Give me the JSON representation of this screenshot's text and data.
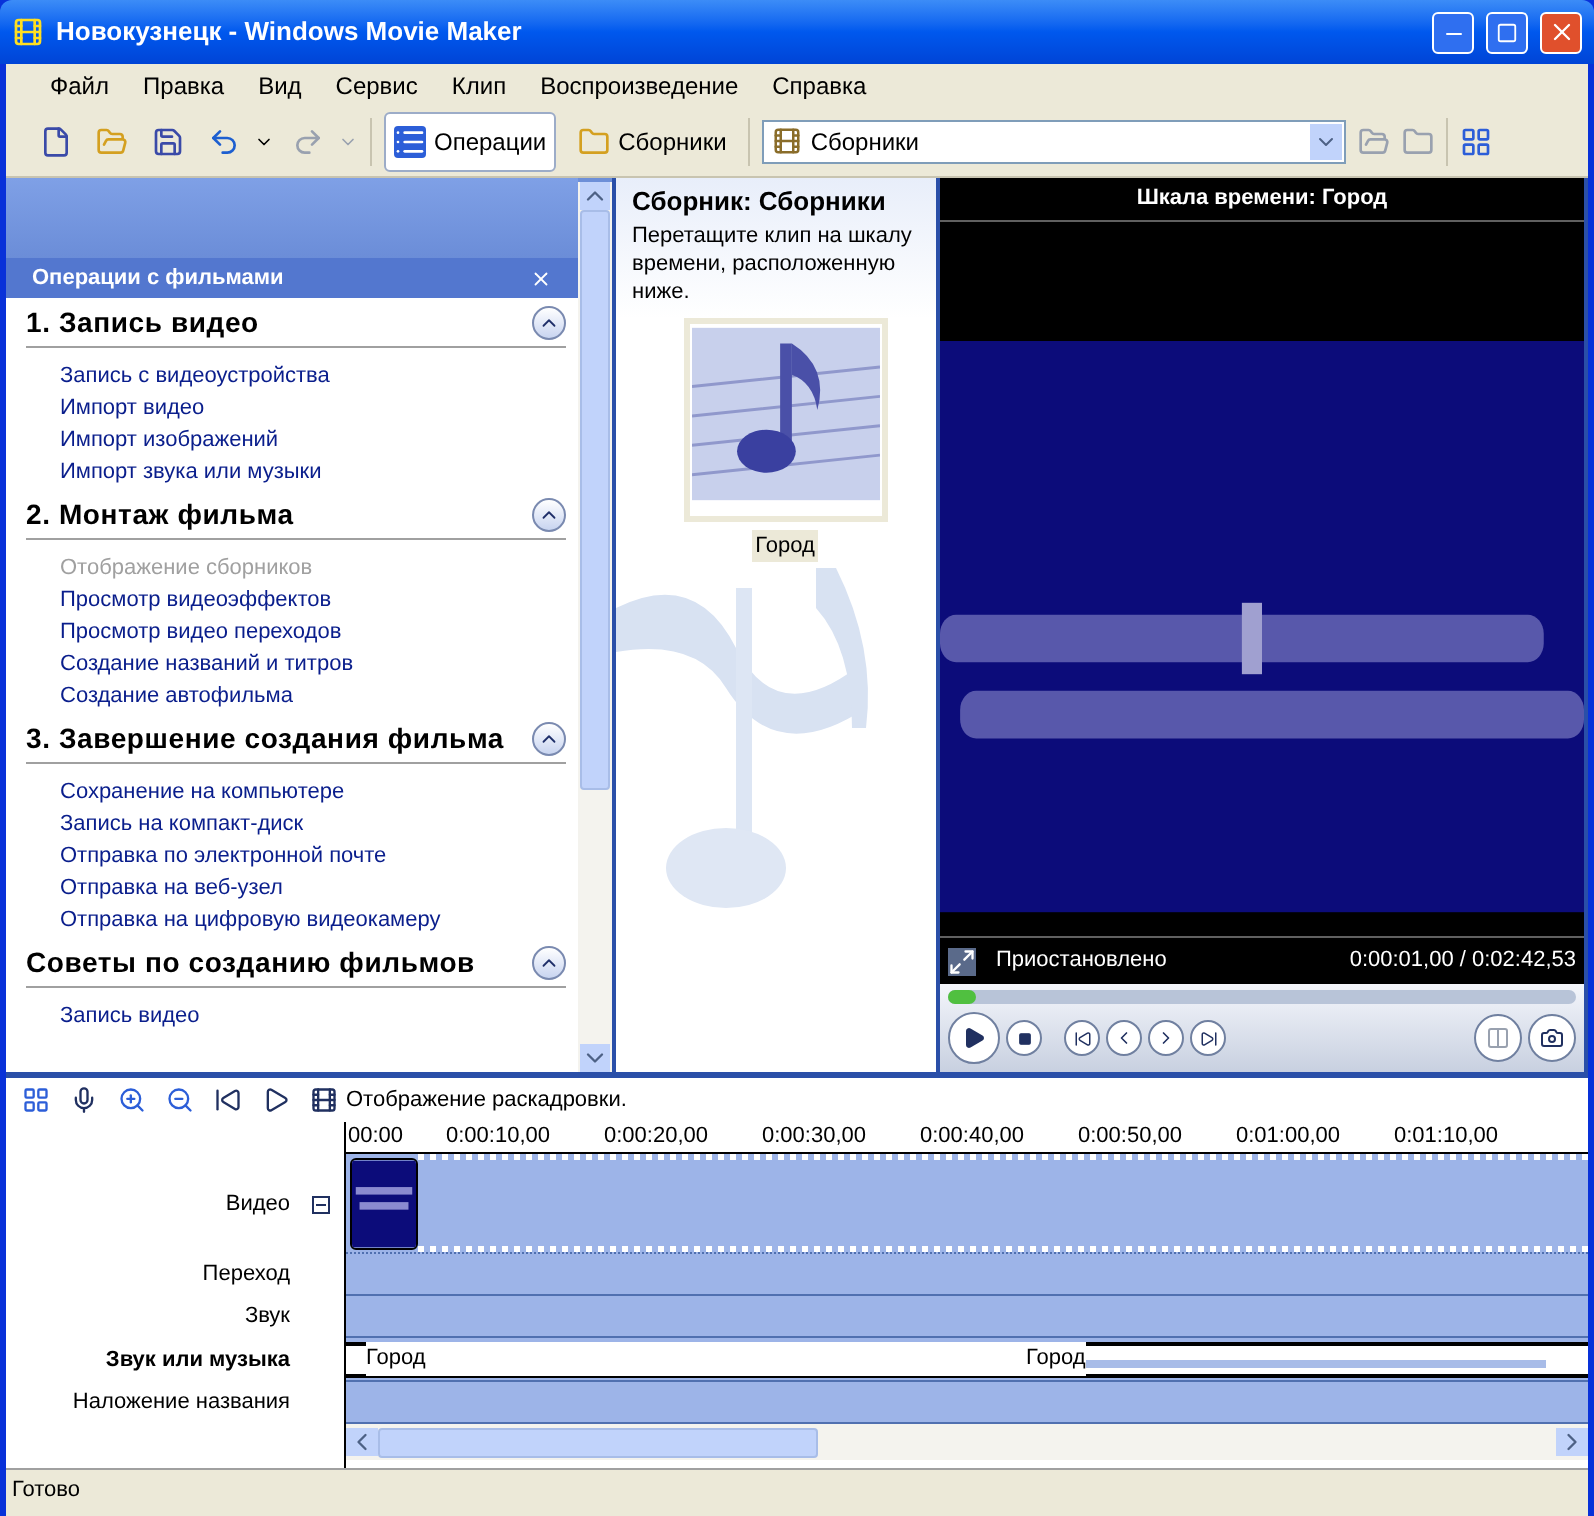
{
  "window": {
    "title": "Новокузнецк - Windows Movie Maker"
  },
  "menu": [
    "Файл",
    "Правка",
    "Вид",
    "Сервис",
    "Клип",
    "Воспроизведение",
    "Справка"
  ],
  "toolbar": {
    "buttons": [
      {
        "kind": "new"
      },
      {
        "kind": "open"
      },
      {
        "kind": "save"
      },
      {
        "kind": "undo"
      },
      {
        "kind": "redo",
        "disabled": true
      }
    ],
    "toggles": [
      {
        "kind": "tasks",
        "label": "Операции",
        "selected": true
      },
      {
        "kind": "collections",
        "label": "Сборники",
        "selected": false
      }
    ],
    "collection_select": {
      "value": "Сборники"
    }
  },
  "task_pane": {
    "title": "Операции с фильмами",
    "sections": [
      {
        "title": "1. Запись видео",
        "expanded": true,
        "items": [
          {
            "label": "Запись с видеоустройства",
            "disabled": false
          },
          {
            "label": "Импорт видео",
            "disabled": false
          },
          {
            "label": "Импорт изображений",
            "disabled": false
          },
          {
            "label": "Импорт звука или музыки",
            "disabled": false
          }
        ]
      },
      {
        "title": "2. Монтаж фильма",
        "expanded": true,
        "items": [
          {
            "label": "Отображение сборников",
            "disabled": true
          },
          {
            "label": "Просмотр видеоэффектов",
            "disabled": false
          },
          {
            "label": "Просмотр видео переходов",
            "disabled": false
          },
          {
            "label": "Создание названий и титров",
            "disabled": false
          },
          {
            "label": "Создание автофильма",
            "disabled": false
          }
        ]
      },
      {
        "title": "3. Завершение создания фильма",
        "expanded": true,
        "items": [
          {
            "label": "Сохранение на компьютере",
            "disabled": false
          },
          {
            "label": "Запись на компакт-диск",
            "disabled": false
          },
          {
            "label": "Отправка по электронной почте",
            "disabled": false
          },
          {
            "label": "Отправка на веб-узел",
            "disabled": false
          },
          {
            "label": "Отправка на цифровую видеокамеру",
            "disabled": false
          }
        ]
      },
      {
        "title": "Советы по созданию фильмов",
        "expanded": true,
        "items": [
          {
            "label": "Запись видео",
            "disabled": false
          }
        ]
      }
    ]
  },
  "collection": {
    "title": "Сборник: Сборники",
    "hint": "Перетащите клип на шкалу времени, расположенную ниже.",
    "clips": [
      {
        "label": "Город",
        "selected": true
      }
    ]
  },
  "preview": {
    "title": "Шкала времени: Город",
    "status": "Приостановлено",
    "time": "0:00:01,00 / 0:02:42,53",
    "level": 0.02
  },
  "timeline": {
    "view_label": "Отображение раскадровки.",
    "ticks": [
      "00:00",
      "0:00:10,00",
      "0:00:20,00",
      "0:00:30,00",
      "0:00:40,00",
      "0:00:50,00",
      "0:01:00,00",
      "0:01:10,00"
    ],
    "tracks": [
      {
        "kind": "video",
        "label": "Видео",
        "bold": false,
        "expanded": true
      },
      {
        "kind": "transition",
        "label": "Переход",
        "bold": false
      },
      {
        "kind": "audio",
        "label": "Звук",
        "bold": false
      },
      {
        "kind": "music",
        "label": "Звук или музыка",
        "bold": true,
        "clips": [
          "Город",
          "Город"
        ]
      },
      {
        "kind": "title",
        "label": "Наложение названия",
        "bold": false
      }
    ]
  },
  "status_bar": "Готово"
}
